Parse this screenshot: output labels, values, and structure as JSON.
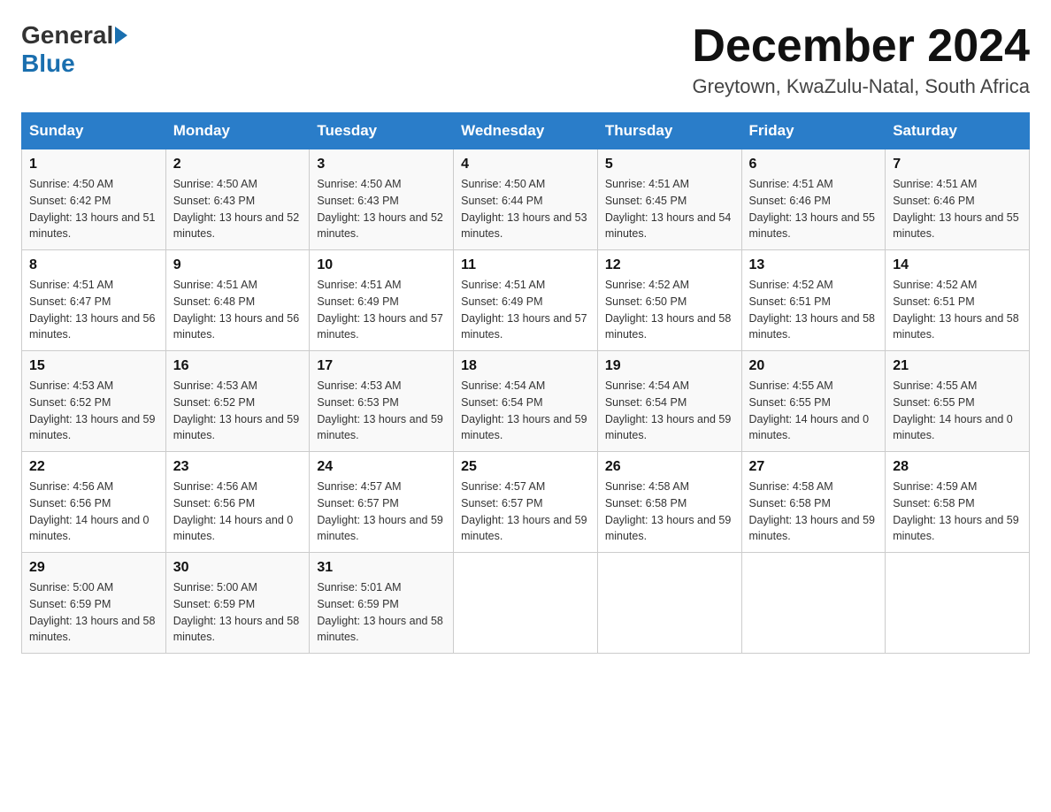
{
  "header": {
    "logo_general": "General",
    "logo_blue": "Blue",
    "month_title": "December 2024",
    "location": "Greytown, KwaZulu-Natal, South Africa"
  },
  "weekdays": [
    "Sunday",
    "Monday",
    "Tuesday",
    "Wednesday",
    "Thursday",
    "Friday",
    "Saturday"
  ],
  "weeks": [
    [
      {
        "day": "1",
        "sunrise": "4:50 AM",
        "sunset": "6:42 PM",
        "daylight": "13 hours and 51 minutes."
      },
      {
        "day": "2",
        "sunrise": "4:50 AM",
        "sunset": "6:43 PM",
        "daylight": "13 hours and 52 minutes."
      },
      {
        "day": "3",
        "sunrise": "4:50 AM",
        "sunset": "6:43 PM",
        "daylight": "13 hours and 52 minutes."
      },
      {
        "day": "4",
        "sunrise": "4:50 AM",
        "sunset": "6:44 PM",
        "daylight": "13 hours and 53 minutes."
      },
      {
        "day": "5",
        "sunrise": "4:51 AM",
        "sunset": "6:45 PM",
        "daylight": "13 hours and 54 minutes."
      },
      {
        "day": "6",
        "sunrise": "4:51 AM",
        "sunset": "6:46 PM",
        "daylight": "13 hours and 55 minutes."
      },
      {
        "day": "7",
        "sunrise": "4:51 AM",
        "sunset": "6:46 PM",
        "daylight": "13 hours and 55 minutes."
      }
    ],
    [
      {
        "day": "8",
        "sunrise": "4:51 AM",
        "sunset": "6:47 PM",
        "daylight": "13 hours and 56 minutes."
      },
      {
        "day": "9",
        "sunrise": "4:51 AM",
        "sunset": "6:48 PM",
        "daylight": "13 hours and 56 minutes."
      },
      {
        "day": "10",
        "sunrise": "4:51 AM",
        "sunset": "6:49 PM",
        "daylight": "13 hours and 57 minutes."
      },
      {
        "day": "11",
        "sunrise": "4:51 AM",
        "sunset": "6:49 PM",
        "daylight": "13 hours and 57 minutes."
      },
      {
        "day": "12",
        "sunrise": "4:52 AM",
        "sunset": "6:50 PM",
        "daylight": "13 hours and 58 minutes."
      },
      {
        "day": "13",
        "sunrise": "4:52 AM",
        "sunset": "6:51 PM",
        "daylight": "13 hours and 58 minutes."
      },
      {
        "day": "14",
        "sunrise": "4:52 AM",
        "sunset": "6:51 PM",
        "daylight": "13 hours and 58 minutes."
      }
    ],
    [
      {
        "day": "15",
        "sunrise": "4:53 AM",
        "sunset": "6:52 PM",
        "daylight": "13 hours and 59 minutes."
      },
      {
        "day": "16",
        "sunrise": "4:53 AM",
        "sunset": "6:52 PM",
        "daylight": "13 hours and 59 minutes."
      },
      {
        "day": "17",
        "sunrise": "4:53 AM",
        "sunset": "6:53 PM",
        "daylight": "13 hours and 59 minutes."
      },
      {
        "day": "18",
        "sunrise": "4:54 AM",
        "sunset": "6:54 PM",
        "daylight": "13 hours and 59 minutes."
      },
      {
        "day": "19",
        "sunrise": "4:54 AM",
        "sunset": "6:54 PM",
        "daylight": "13 hours and 59 minutes."
      },
      {
        "day": "20",
        "sunrise": "4:55 AM",
        "sunset": "6:55 PM",
        "daylight": "14 hours and 0 minutes."
      },
      {
        "day": "21",
        "sunrise": "4:55 AM",
        "sunset": "6:55 PM",
        "daylight": "14 hours and 0 minutes."
      }
    ],
    [
      {
        "day": "22",
        "sunrise": "4:56 AM",
        "sunset": "6:56 PM",
        "daylight": "14 hours and 0 minutes."
      },
      {
        "day": "23",
        "sunrise": "4:56 AM",
        "sunset": "6:56 PM",
        "daylight": "14 hours and 0 minutes."
      },
      {
        "day": "24",
        "sunrise": "4:57 AM",
        "sunset": "6:57 PM",
        "daylight": "13 hours and 59 minutes."
      },
      {
        "day": "25",
        "sunrise": "4:57 AM",
        "sunset": "6:57 PM",
        "daylight": "13 hours and 59 minutes."
      },
      {
        "day": "26",
        "sunrise": "4:58 AM",
        "sunset": "6:58 PM",
        "daylight": "13 hours and 59 minutes."
      },
      {
        "day": "27",
        "sunrise": "4:58 AM",
        "sunset": "6:58 PM",
        "daylight": "13 hours and 59 minutes."
      },
      {
        "day": "28",
        "sunrise": "4:59 AM",
        "sunset": "6:58 PM",
        "daylight": "13 hours and 59 minutes."
      }
    ],
    [
      {
        "day": "29",
        "sunrise": "5:00 AM",
        "sunset": "6:59 PM",
        "daylight": "13 hours and 58 minutes."
      },
      {
        "day": "30",
        "sunrise": "5:00 AM",
        "sunset": "6:59 PM",
        "daylight": "13 hours and 58 minutes."
      },
      {
        "day": "31",
        "sunrise": "5:01 AM",
        "sunset": "6:59 PM",
        "daylight": "13 hours and 58 minutes."
      },
      null,
      null,
      null,
      null
    ]
  ]
}
